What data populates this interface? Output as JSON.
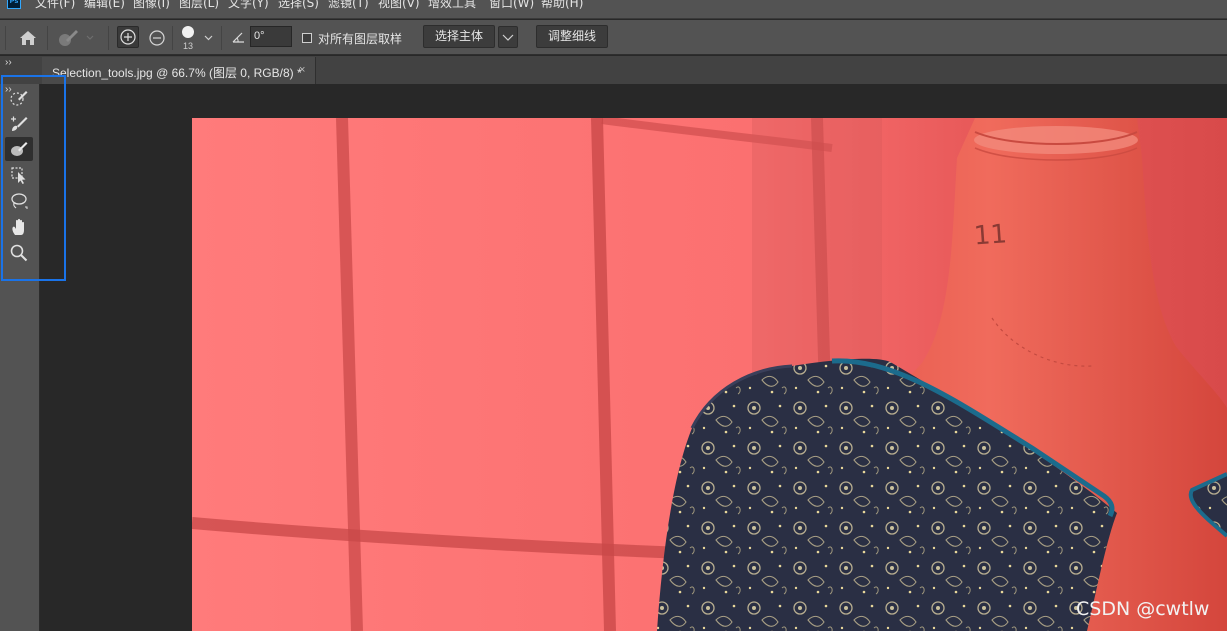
{
  "menu": {
    "logo": "Ps",
    "items": [
      "文件(F)",
      "编辑(E)",
      "图像(I)",
      "图层(L)",
      "文字(Y)",
      "选择(S)",
      "滤镜(T)",
      "视图(V)",
      "增效工具",
      "窗口(W)",
      "帮助(H)"
    ]
  },
  "options": {
    "home_icon": "home-icon",
    "brush_size": "13",
    "angle_value": "0°",
    "sample_all_layers_label": "对所有图层取样",
    "sample_all_layers_checked": false,
    "select_subject_label": "选择主体",
    "refine_edge_label": "调整细线"
  },
  "tab": {
    "collapse": "››",
    "title": "Selection_tools.jpg @ 66.7% (图层 0, RGB/8) *",
    "close": "×"
  },
  "toolbar": {
    "grip": "››",
    "tools": [
      {
        "name": "quick-selection-tool",
        "icon": "dashed-brush-icon",
        "active": false
      },
      {
        "name": "select-brush-tool",
        "icon": "brush-plus-icon",
        "active": false
      },
      {
        "name": "select-and-mask-brush-tool",
        "icon": "brush-mask-icon",
        "active": true
      },
      {
        "name": "object-selection-tool",
        "icon": "object-select-icon",
        "active": false
      },
      {
        "name": "lasso-tool",
        "icon": "lasso-icon",
        "active": false
      },
      {
        "name": "hand-tool",
        "icon": "hand-icon",
        "active": false
      },
      {
        "name": "zoom-tool",
        "icon": "magnifier-icon",
        "active": false
      }
    ],
    "highlight_color": "#1a73e8"
  },
  "canvas": {
    "overlay_color": "#ff6e6e",
    "watermark": "CSDN @cwtlw"
  }
}
